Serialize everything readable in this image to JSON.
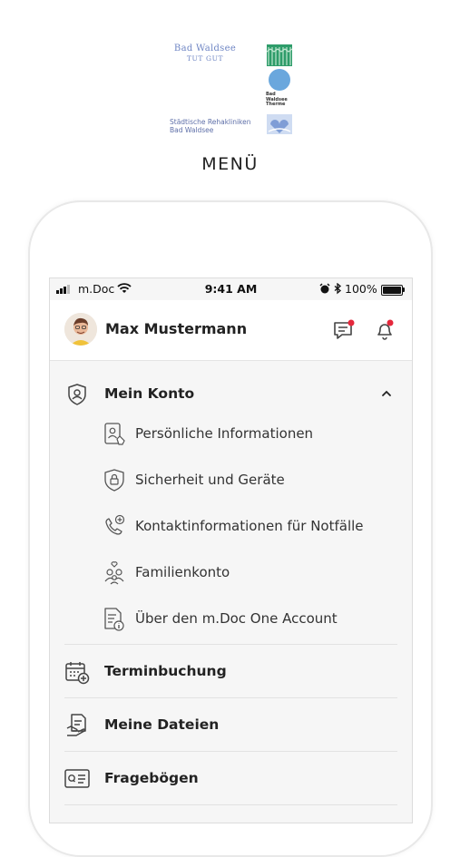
{
  "logos": {
    "bad_waldsee": {
      "line1": "Bad Waldsee",
      "line2": "TUT GUT"
    },
    "therme": {
      "caption": "Bad Waldsee Therme"
    },
    "reha": {
      "line1": "Städtische Rehakliniken",
      "line2": "Bad Waldsee"
    }
  },
  "page": {
    "title": "MENÜ"
  },
  "status_bar": {
    "carrier": "m.Doc",
    "time": "9:41 AM",
    "battery": "100%"
  },
  "profile": {
    "name": "Max Mustermann",
    "message_badge": true,
    "notification_badge": true
  },
  "menu": {
    "mein_konto": {
      "label": "Mein Konto",
      "expanded": true,
      "items": [
        {
          "label": "Persönliche Informationen",
          "icon": "id-card-icon"
        },
        {
          "label": "Sicherheit und Geräte",
          "icon": "shield-lock-icon"
        },
        {
          "label": "Kontaktinformationen für Notfälle",
          "icon": "phone-plus-icon"
        },
        {
          "label": "Familienkonto",
          "icon": "family-icon"
        },
        {
          "label": "Über den m.Doc One Account",
          "icon": "document-info-icon"
        }
      ]
    },
    "terminbuchung": {
      "label": "Terminbuchung",
      "icon": "calendar-plus-icon"
    },
    "meine_dateien": {
      "label": "Meine Dateien",
      "icon": "files-icon"
    },
    "frageboegen": {
      "label": "Fragebögen",
      "icon": "questionnaire-icon"
    }
  },
  "colors": {
    "accent_badge": "#e5283c",
    "logo_blue": "#6f86c4",
    "logo_green": "#2e9c6a"
  }
}
